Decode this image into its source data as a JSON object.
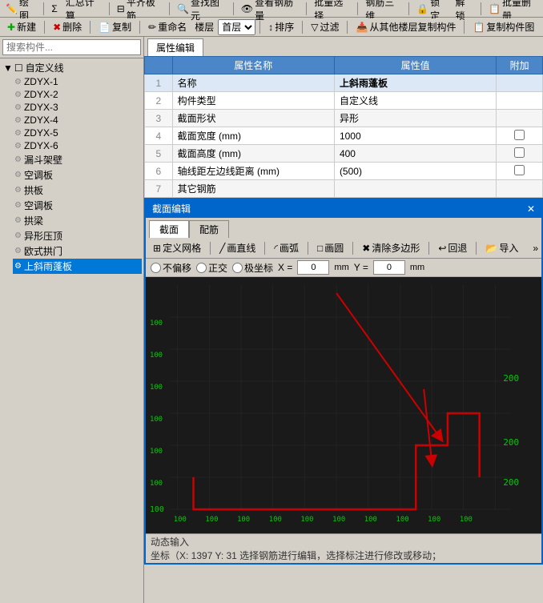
{
  "toolbar1": {
    "items": [
      {
        "label": "绘图",
        "name": "draw-menu"
      },
      {
        "label": "Σ",
        "name": "sigma"
      },
      {
        "label": "汇总计算",
        "name": "calc-menu"
      },
      {
        "label": "平齐板筋",
        "name": "align-board"
      },
      {
        "label": "查找图元",
        "name": "find-element"
      },
      {
        "label": "查看钢筋量",
        "name": "view-rebar"
      },
      {
        "label": "批量选择",
        "name": "batch-select"
      },
      {
        "label": "钢筋三维",
        "name": "rebar-3d"
      },
      {
        "label": "锁定",
        "name": "lock"
      },
      {
        "label": "解锁",
        "name": "unlock"
      },
      {
        "label": "批量删册",
        "name": "batch-delete"
      }
    ]
  },
  "toolbar2": {
    "new_label": "新建",
    "delete_label": "删除",
    "copy_label": "复制",
    "rename_label": "重命名",
    "floor_label": "楼层",
    "floor_value": "首层",
    "sort_label": "排序",
    "filter_label": "过滤",
    "from_other_label": "从其他楼层复制构件",
    "copy_component_label": "复制构件图"
  },
  "sidebar": {
    "search_placeholder": "搜索构件...",
    "tree": {
      "root_label": "自定义线",
      "items": [
        {
          "label": "ZDYX-1",
          "selected": false
        },
        {
          "label": "ZDYX-2",
          "selected": false
        },
        {
          "label": "ZDYX-3",
          "selected": false
        },
        {
          "label": "ZDYX-4",
          "selected": false
        },
        {
          "label": "ZDYX-5",
          "selected": false
        },
        {
          "label": "ZDYX-6",
          "selected": false
        },
        {
          "label": "漏斗架壁",
          "selected": false
        },
        {
          "label": "空调板",
          "selected": false
        },
        {
          "label": "拱板",
          "selected": false
        },
        {
          "label": "空调板",
          "selected": false
        },
        {
          "label": "拱梁",
          "selected": false
        },
        {
          "label": "异形压顶",
          "selected": false
        },
        {
          "label": "欧式拱门",
          "selected": false
        },
        {
          "label": "上斜雨蓬板",
          "selected": true
        }
      ]
    }
  },
  "property_editor": {
    "tab_label": "属性编辑",
    "table": {
      "col_name": "属性名称",
      "col_value": "属性值",
      "col_extra": "附加",
      "rows": [
        {
          "num": "1",
          "name": "名称",
          "value": "上斜雨蓬板",
          "has_checkbox": false
        },
        {
          "num": "2",
          "name": "构件类型",
          "value": "自定义线",
          "has_checkbox": false
        },
        {
          "num": "3",
          "name": "截面形状",
          "value": "异形",
          "has_checkbox": false
        },
        {
          "num": "4",
          "name": "截面宽度 (mm)",
          "value": "1000",
          "has_checkbox": true
        },
        {
          "num": "5",
          "name": "截面高度 (mm)",
          "value": "400",
          "has_checkbox": true
        },
        {
          "num": "6",
          "name": "轴线距左边线距离 (mm)",
          "value": "(500)",
          "has_checkbox": true
        },
        {
          "num": "7",
          "name": "其它钢筋",
          "value": "",
          "has_checkbox": false
        }
      ]
    }
  },
  "section_editor": {
    "title": "截面编辑",
    "tabs": [
      {
        "label": "截面",
        "active": true
      },
      {
        "label": "配筋",
        "active": false
      }
    ],
    "toolbar": {
      "define_grid": "定义网格",
      "draw_line": "画直线",
      "draw_arc": "画弧",
      "draw_rect": "画圆",
      "clear_poly": "清除多边形",
      "undo": "回退",
      "import": "导入"
    },
    "coord_bar": {
      "no_offset": "不偏移",
      "normal": "正交",
      "polar": "极坐标",
      "x_label": "X =",
      "x_value": "0",
      "y_label": "Y =",
      "y_value": "0",
      "unit": "mm"
    },
    "grid_labels_x": [
      "100",
      "100",
      "100",
      "100",
      "100",
      "100",
      "100",
      "100",
      "100",
      "100"
    ],
    "grid_labels_y": [
      "200",
      "200",
      "200"
    ],
    "grid_left_labels": [
      "100",
      "100",
      "100",
      "100",
      "100",
      "100",
      "100"
    ],
    "dynamic_input": "动态输入"
  },
  "status_bar": {
    "line1": "动态输入",
    "line2": "坐标（X: 1397 Y: 31 选择钢筋进行编辑，选择标注进行修改或移动；"
  }
}
